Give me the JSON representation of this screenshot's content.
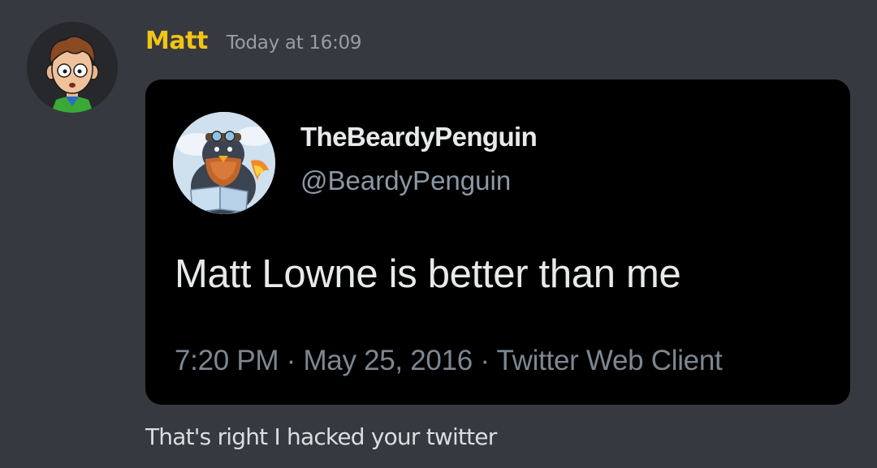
{
  "message": {
    "author": "Matt",
    "timestamp": "Today at 16:09",
    "author_color": "#f2c415",
    "avatar_icon": "cartoon-avatar-icon",
    "content": "That's right I hacked your twitter"
  },
  "tweet": {
    "display_name": "TheBeardyPenguin",
    "handle": "@BeardyPenguin",
    "avatar_icon": "bearded-penguin-avatar-icon",
    "text": "Matt Lowne is better than me",
    "meta": "7:20 PM · May 25, 2016 · Twitter Web Client"
  }
}
